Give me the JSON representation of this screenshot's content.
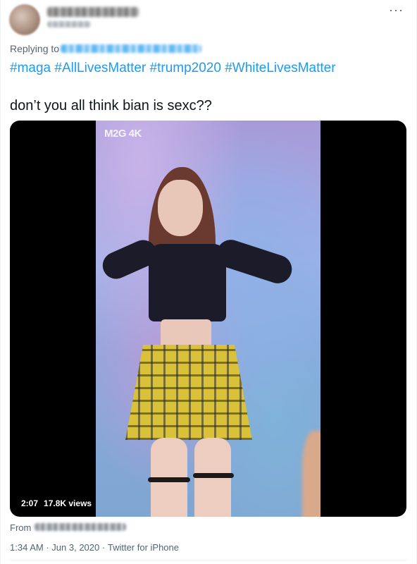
{
  "tweet": {
    "more_icon": "more-horizontal-icon",
    "replying_label": "Replying to",
    "hashtags": "#maga #AllLivesMatter #trump2020 #WhiteLivesMatter",
    "text": "don’t you all think bian is sexc??",
    "media": {
      "watermark": "M2G 4K",
      "duration": "2:07",
      "views": "17.8K views"
    },
    "from_label": "From",
    "time": "1:34 AM",
    "separator": "·",
    "date": "Jun 3, 2020",
    "source": "Twitter for iPhone"
  },
  "colors": {
    "link": "#1d9bf0",
    "secondary_text": "#536471",
    "primary_text": "#0f1419"
  }
}
